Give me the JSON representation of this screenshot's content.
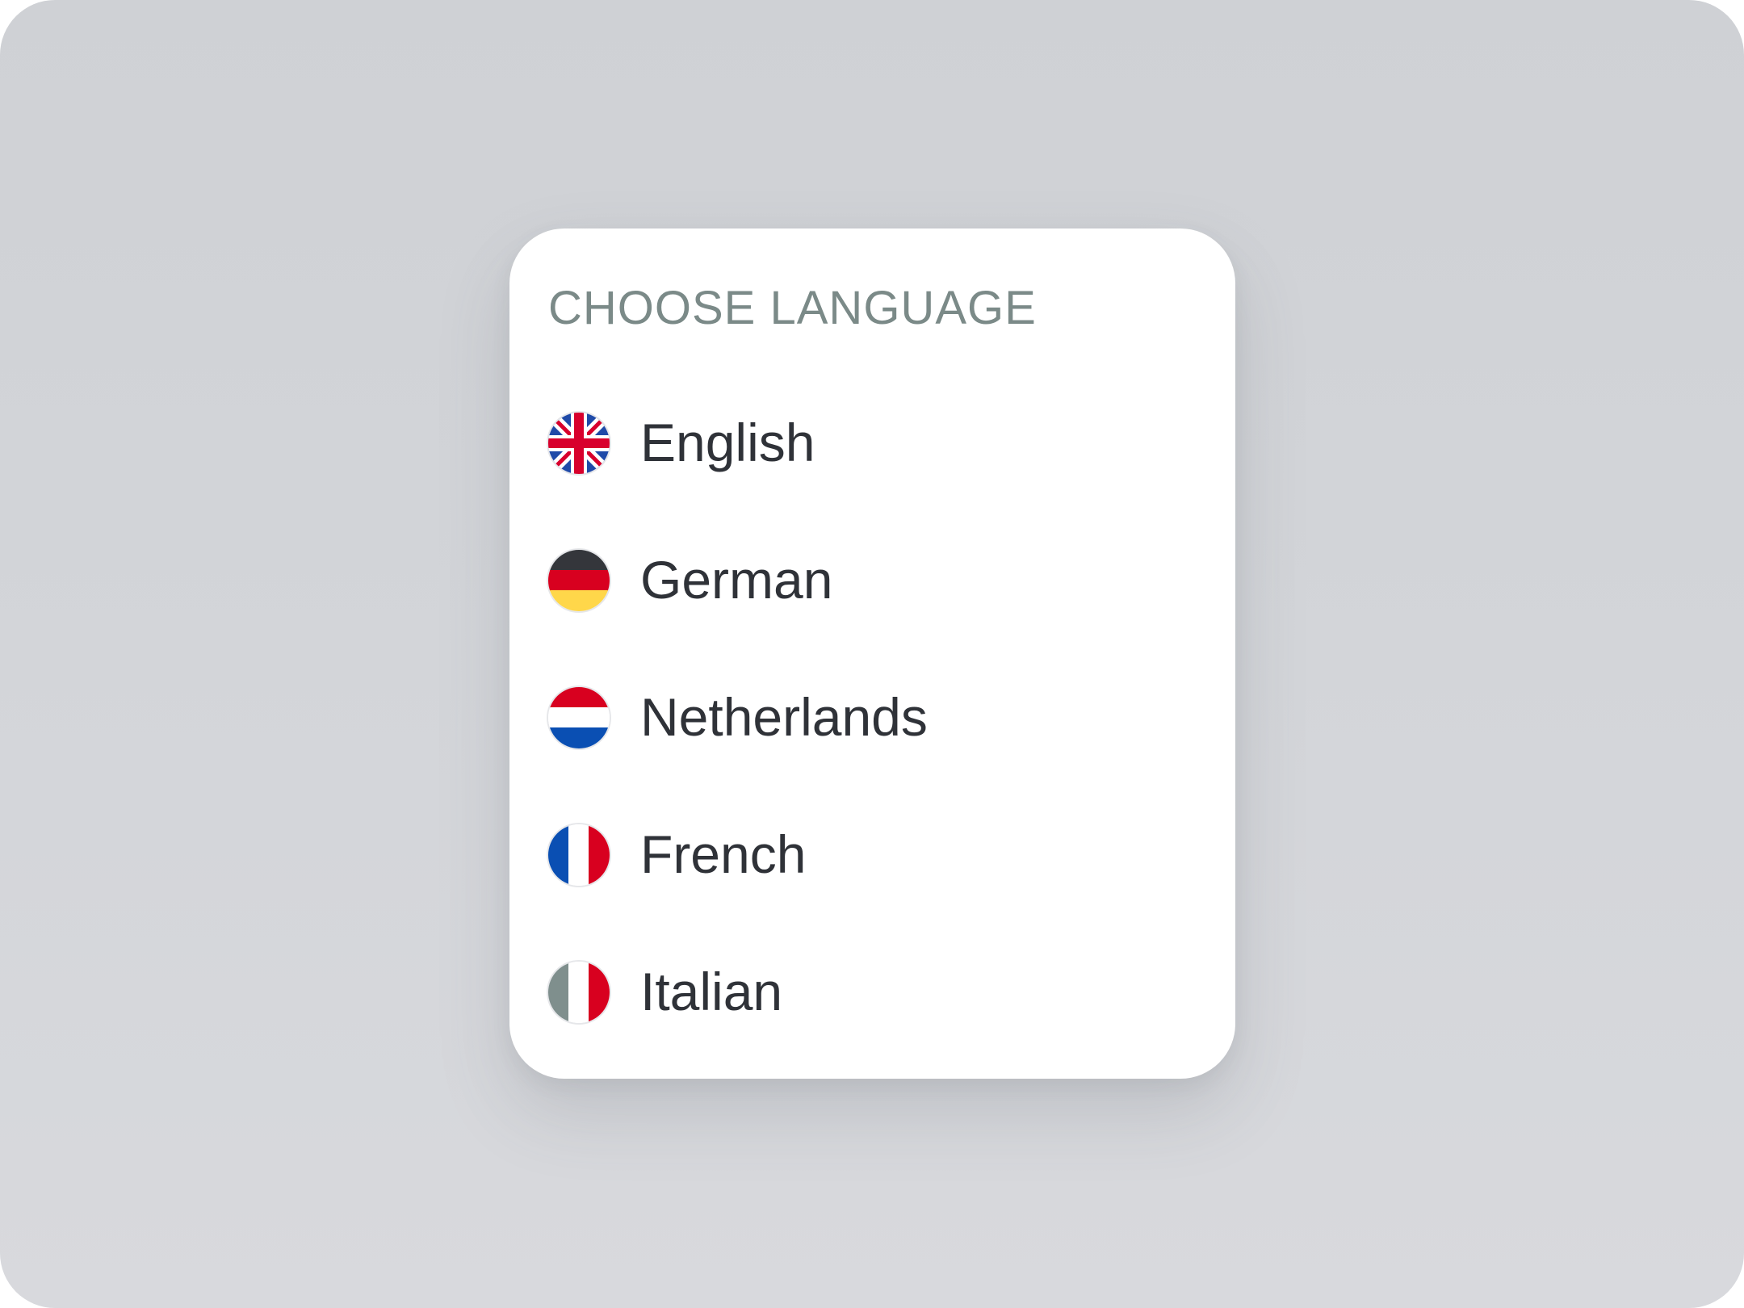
{
  "dialog": {
    "title": "CHOOSE LANGUAGE"
  },
  "languages": [
    {
      "label": "English",
      "flag": "uk-flag-icon"
    },
    {
      "label": "German",
      "flag": "germany-flag-icon"
    },
    {
      "label": "Netherlands",
      "flag": "netherlands-flag-icon"
    },
    {
      "label": "French",
      "flag": "france-flag-icon"
    },
    {
      "label": "Italian",
      "flag": "italy-flag-icon"
    }
  ],
  "colors": {
    "background": "#d1d3d7",
    "card": "#ffffff",
    "title_text": "#7b8a88",
    "item_text": "#2f3238",
    "uk_blue": "#1f4aa8",
    "uk_red": "#d8002c",
    "de_black": "#34363b",
    "de_red": "#d8001f",
    "de_gold": "#ffd74a",
    "nl_red": "#d8001f",
    "nl_blue": "#0a4fb3",
    "fr_blue": "#0a4fb3",
    "fr_red": "#d8001f",
    "it_green": "#7f8f8d",
    "it_red": "#d8001f"
  }
}
